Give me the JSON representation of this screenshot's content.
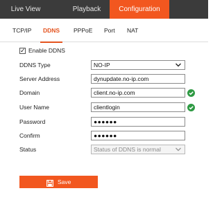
{
  "topnav": {
    "live_view": "Live View",
    "playback": "Playback",
    "configuration": "Configuration"
  },
  "subtabs": [
    "TCP/IP",
    "DDNS",
    "PPPoE",
    "Port",
    "NAT"
  ],
  "active_subtab": "DDNS",
  "form": {
    "enable_label": "Enable DDNS",
    "enable_checked": true,
    "ddns_type_label": "DDNS Type",
    "ddns_type_value": "NO-IP",
    "server_address_label": "Server Address",
    "server_address_value": "dynupdate.no-ip.com",
    "domain_label": "Domain",
    "domain_value": "client.no-ip.com",
    "user_name_label": "User Name",
    "user_name_value": "clientlogin",
    "password_label": "Password",
    "password_value": "●●●●●●",
    "confirm_label": "Confirm",
    "confirm_value": "●●●●●●",
    "status_label": "Status",
    "status_value": "Status of DDNS is normal"
  },
  "save_label": "Save",
  "colors": {
    "accent": "#f2571f",
    "topbar": "#3b3b3b",
    "valid": "#2e9a43"
  }
}
